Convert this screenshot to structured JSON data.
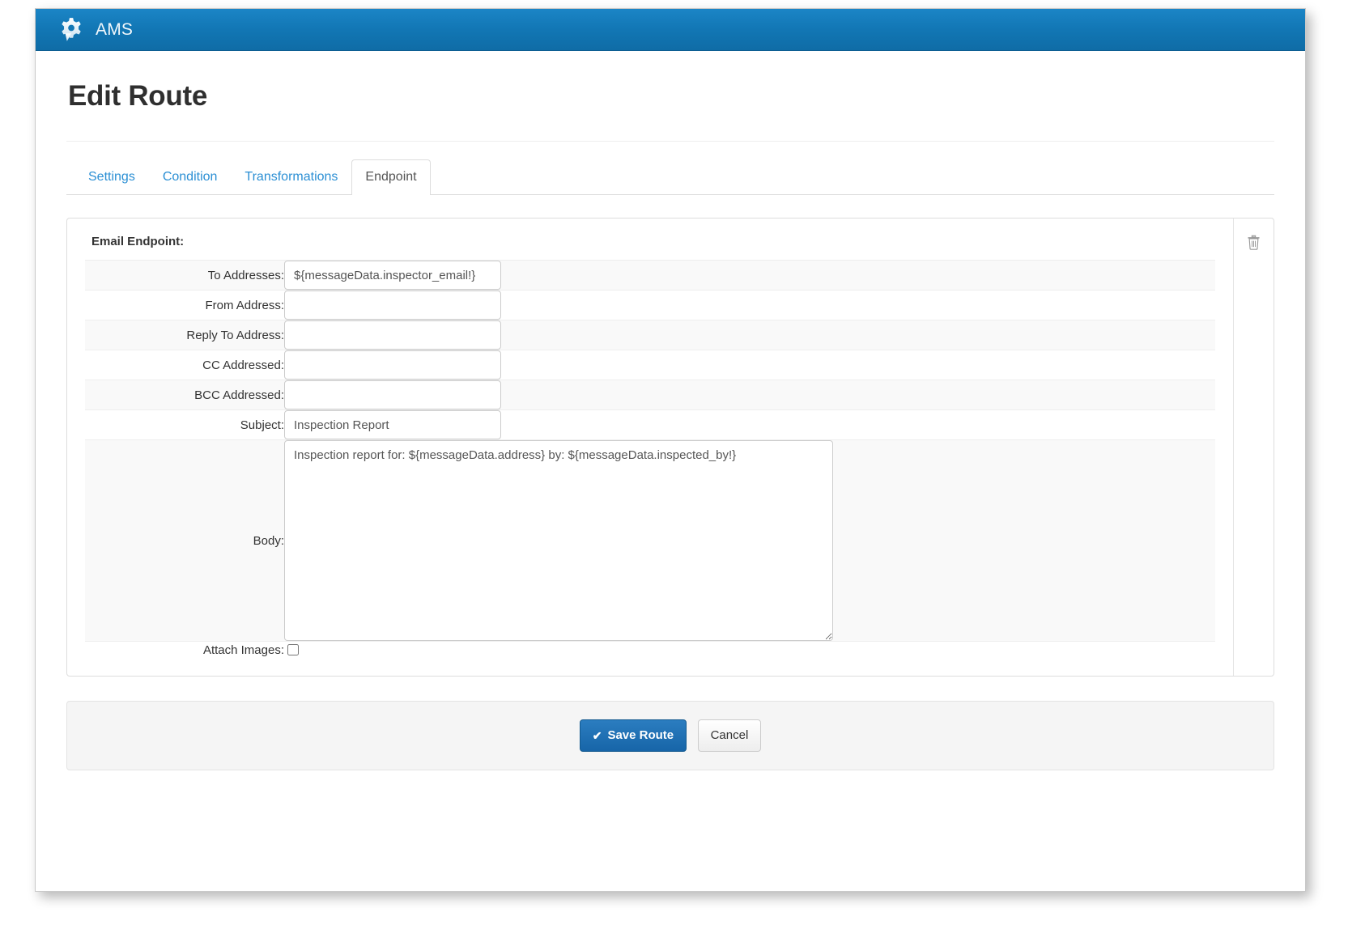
{
  "navbar": {
    "brand_label": "AMS",
    "brand_icon": "gear-speech-bubble-icon",
    "background_color": "#1277b5"
  },
  "page": {
    "title": "Edit Route"
  },
  "tabs": [
    {
      "label": "Settings",
      "active": false
    },
    {
      "label": "Condition",
      "active": false
    },
    {
      "label": "Transformations",
      "active": false
    },
    {
      "label": "Endpoint",
      "active": true
    }
  ],
  "endpoint_panel": {
    "section_label": "Email Endpoint:",
    "delete_icon": "trash-icon",
    "fields": [
      {
        "label": "To Addresses:",
        "value": "${messageData.inspector_email!}",
        "placeholder": ""
      },
      {
        "label": "From Address:",
        "value": "",
        "placeholder": ""
      },
      {
        "label": "Reply To Address:",
        "value": "",
        "placeholder": ""
      },
      {
        "label": "CC Addressed:",
        "value": "",
        "placeholder": ""
      },
      {
        "label": "BCC Addressed:",
        "value": "",
        "placeholder": ""
      },
      {
        "label": "Subject:",
        "value": "Inspection Report",
        "placeholder": ""
      }
    ],
    "body_field": {
      "label": "Body:",
      "value": "Inspection report for: ${messageData.address} by: ${messageData.inspected_by!}",
      "placeholder": ""
    },
    "attach_images": {
      "label": "Attach Images:",
      "checked": false
    }
  },
  "footer": {
    "save_label": "Save Route",
    "save_icon": "check-icon",
    "cancel_label": "Cancel",
    "save_color": "#1765a8"
  }
}
